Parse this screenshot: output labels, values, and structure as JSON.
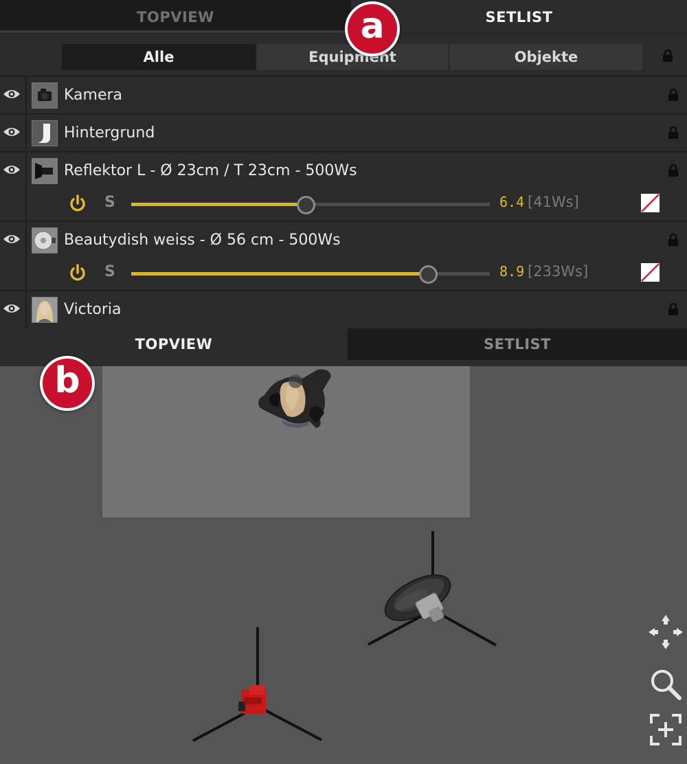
{
  "panel_a": {
    "tabs": [
      {
        "label": "TOPVIEW",
        "active": false
      },
      {
        "label": "SETLIST",
        "active": true
      }
    ],
    "badge": "a",
    "filters": [
      {
        "label": "Alle",
        "active": true
      },
      {
        "label": "Equipment",
        "active": false
      },
      {
        "label": "Objekte",
        "active": false
      }
    ],
    "items": [
      {
        "name": "Kamera",
        "icon": "camera-thumbnail",
        "has_controls": false
      },
      {
        "name": "Hintergrund",
        "icon": "backdrop-thumbnail",
        "has_controls": false
      },
      {
        "name": "Reflektor L - Ø 23cm / T 23cm - 500Ws",
        "icon": "reflector-thumbnail",
        "has_controls": true,
        "power_value": "6.4",
        "energy": "[41Ws]",
        "slider_fraction": 0.485,
        "s_label": "S"
      },
      {
        "name": "Beautydish weiss - Ø 56 cm - 500Ws",
        "icon": "beautydish-thumbnail",
        "has_controls": true,
        "power_value": "8.9",
        "energy": "[233Ws]",
        "slider_fraction": 0.825,
        "s_label": "S"
      },
      {
        "name": "Victoria",
        "icon": "model-portrait-thumbnail",
        "has_controls": false
      }
    ]
  },
  "panel_b": {
    "tabs": [
      {
        "label": "TOPVIEW",
        "active": true
      },
      {
        "label": "SETLIST",
        "active": false
      }
    ],
    "badge": "b",
    "nav_icons": [
      "move-icon",
      "zoom-icon",
      "fit-view-icon"
    ]
  },
  "colors": {
    "accent_yellow": "#d8b52a",
    "badge_red": "#c8102e",
    "panel_bg": "#2b2b2b",
    "viewport_bg": "#555555"
  }
}
